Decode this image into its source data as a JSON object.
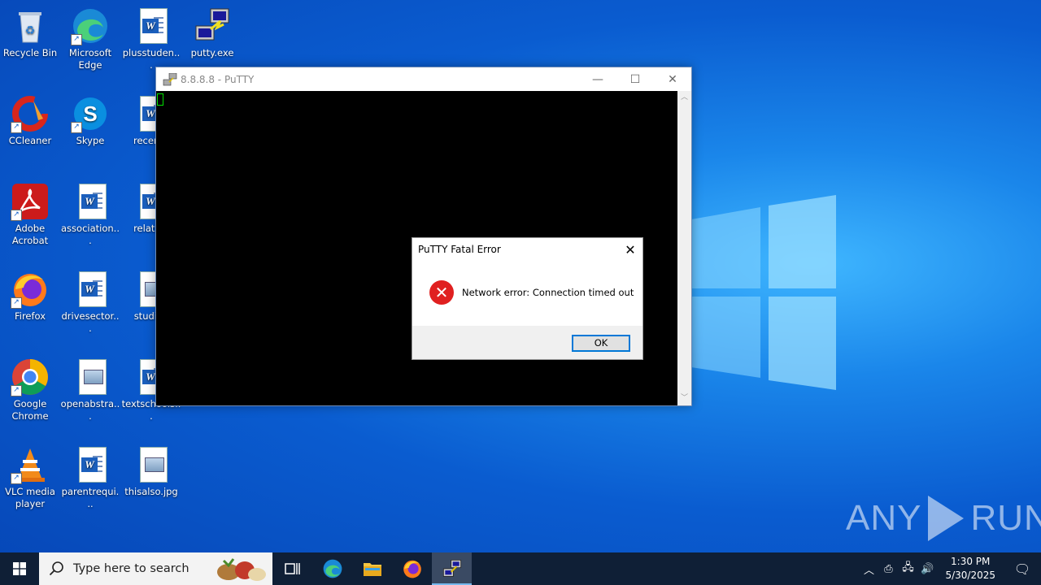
{
  "desktop": {
    "icons": [
      {
        "label": "Recycle Bin"
      },
      {
        "label": "Microsoft Edge"
      },
      {
        "label": "plusstuden..."
      },
      {
        "label": "putty.exe"
      },
      {
        "label": "CCleaner"
      },
      {
        "label": "Skype"
      },
      {
        "label": "recenth"
      },
      {
        "label": "Adobe Acrobat"
      },
      {
        "label": "association..."
      },
      {
        "label": "relation"
      },
      {
        "label": "Firefox"
      },
      {
        "label": "drivesector..."
      },
      {
        "label": "studiop"
      },
      {
        "label": "Google Chrome"
      },
      {
        "label": "openabstra..."
      },
      {
        "label": "textschools..."
      },
      {
        "label": "VLC media player"
      },
      {
        "label": "parentrequi..."
      },
      {
        "label": "thisalso.jpg"
      }
    ]
  },
  "putty": {
    "title": "8.8.8.8 - PuTTY",
    "minimize": "—",
    "maximize": "☐",
    "close": "✕"
  },
  "dialog": {
    "title": "PuTTY Fatal Error",
    "close": "✕",
    "message": "Network error: Connection timed out",
    "ok_label": "OK"
  },
  "watermark": {
    "left": "ANY",
    "right": "RUN"
  },
  "taskbar": {
    "search_placeholder": "Type here to search",
    "time": "1:30 PM",
    "date": "5/30/2025"
  }
}
